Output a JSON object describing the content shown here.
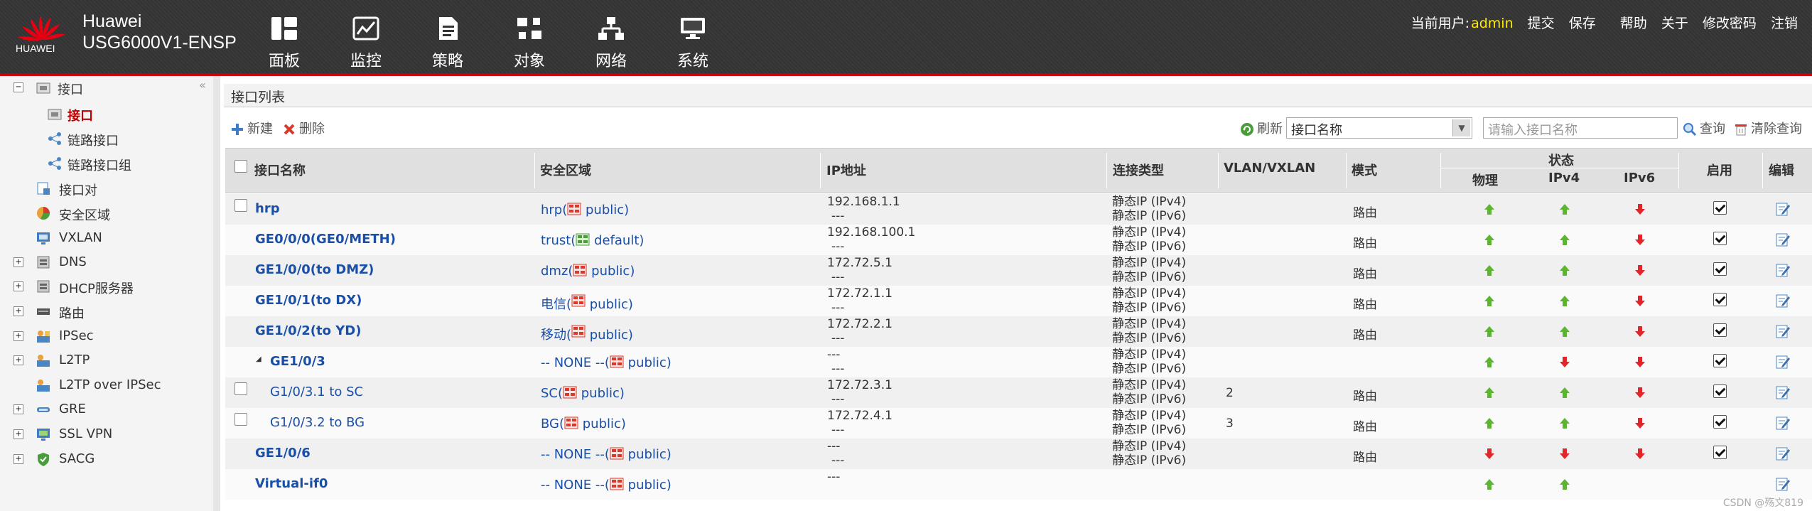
{
  "header": {
    "logo_text": "HUAWEI",
    "brand": "Huawei",
    "product": "USG6000V1-ENSP",
    "nav": [
      {
        "label": "面板",
        "icon": "dashboard-icon"
      },
      {
        "label": "监控",
        "icon": "monitor-icon"
      },
      {
        "label": "策略",
        "icon": "policy-icon"
      },
      {
        "label": "对象",
        "icon": "object-icon"
      },
      {
        "label": "网络",
        "icon": "network-icon"
      },
      {
        "label": "系统",
        "icon": "system-icon"
      }
    ],
    "current_user_label": "当前用户:",
    "current_user": "admin",
    "links": [
      "提交",
      "保存",
      "帮助",
      "关于",
      "修改密码",
      "注销"
    ],
    "accent": "#c7000b"
  },
  "sidebar": {
    "items": [
      {
        "label": "接口",
        "expander": "−"
      },
      {
        "label": "接口",
        "selected": true
      },
      {
        "label": "链路接口"
      },
      {
        "label": "链路接口组"
      },
      {
        "label": "接口对"
      },
      {
        "label": "安全区域"
      },
      {
        "label": "VXLAN"
      },
      {
        "label": "DNS",
        "expander": "+"
      },
      {
        "label": "DHCP服务器",
        "expander": "+"
      },
      {
        "label": "路由",
        "expander": "+"
      },
      {
        "label": "IPSec",
        "expander": "+"
      },
      {
        "label": "L2TP",
        "expander": "+"
      },
      {
        "label": "L2TP over IPSec"
      },
      {
        "label": "GRE",
        "expander": "+"
      },
      {
        "label": "SSL VPN",
        "expander": "+"
      },
      {
        "label": "SACG",
        "expander": "+"
      }
    ]
  },
  "main": {
    "title": "接口列表",
    "toolbar": {
      "new": "新建",
      "delete": "删除",
      "refresh": "刷新",
      "filter_select": "接口名称",
      "search_placeholder": "请输入接口名称",
      "query": "查询",
      "clear_query": "清除查询"
    },
    "columns": {
      "name": "接口名称",
      "zone": "安全区域",
      "ip": "IP地址",
      "conn": "连接类型",
      "vlan": "VLAN/VXLAN",
      "mode": "模式",
      "status": "状态",
      "status_phys": "物理",
      "status_ipv4": "IPv4",
      "status_ipv6": "IPv6",
      "enable": "启用",
      "edit": "编辑"
    },
    "rows": [
      {
        "name": "hrp",
        "checkbox": true,
        "zone_name": "hrp(",
        "zone_vsys": " public)",
        "ip1": "192.168.1.1",
        "ip2": "---",
        "conn1": "静态IP (IPv4)",
        "conn2": "静态IP (IPv6)",
        "vlan": "",
        "mode": "路由",
        "phys": "up",
        "ipv4": "up",
        "ipv6": "down",
        "enabled": true
      },
      {
        "name": "GE0/0/0(GE0/METH)",
        "checkbox": false,
        "zone_name": "trust(",
        "zone_vsys": " default)",
        "zone_icon": "green",
        "ip1": "192.168.100.1",
        "ip2": "---",
        "conn1": "静态IP (IPv4)",
        "conn2": "静态IP (IPv6)",
        "vlan": "",
        "mode": "路由",
        "phys": "up",
        "ipv4": "up",
        "ipv6": "down",
        "enabled": true
      },
      {
        "name": "GE1/0/0(to DMZ)",
        "checkbox": false,
        "zone_name": "dmz(",
        "zone_vsys": " public)",
        "ip1": "172.72.5.1",
        "ip2": "---",
        "conn1": "静态IP (IPv4)",
        "conn2": "静态IP (IPv6)",
        "vlan": "",
        "mode": "路由",
        "phys": "up",
        "ipv4": "up",
        "ipv6": "down",
        "enabled": true
      },
      {
        "name": "GE1/0/1(to DX)",
        "checkbox": false,
        "zone_name": "电信(",
        "zone_vsys": " public)",
        "ip1": "172.72.1.1",
        "ip2": "---",
        "conn1": "静态IP (IPv4)",
        "conn2": "静态IP (IPv6)",
        "vlan": "",
        "mode": "路由",
        "phys": "up",
        "ipv4": "up",
        "ipv6": "down",
        "enabled": true
      },
      {
        "name": "GE1/0/2(to YD)",
        "checkbox": false,
        "zone_name": "移动(",
        "zone_vsys": " public)",
        "ip1": "172.72.2.1",
        "ip2": "---",
        "conn1": "静态IP (IPv4)",
        "conn2": "静态IP (IPv6)",
        "vlan": "",
        "mode": "路由",
        "phys": "up",
        "ipv4": "up",
        "ipv6": "down",
        "enabled": true
      },
      {
        "name": "GE1/0/3",
        "checkbox": false,
        "expander": "◢",
        "zone_name": "-- NONE --(",
        "zone_vsys": " public)",
        "ip1": "---",
        "ip2": "---",
        "conn1": "静态IP (IPv4)",
        "conn2": "静态IP (IPv6)",
        "vlan": "",
        "mode": "",
        "phys": "up",
        "ipv4": "down",
        "ipv6": "down",
        "enabled": true
      },
      {
        "name": "G1/0/3.1 to SC",
        "checkbox": true,
        "child": true,
        "zone_name": "SC(",
        "zone_vsys": " public)",
        "ip1": "172.72.3.1",
        "ip2": "---",
        "conn1": "静态IP (IPv4)",
        "conn2": "静态IP (IPv6)",
        "vlan": "2",
        "mode": "路由",
        "phys": "up",
        "ipv4": "up",
        "ipv6": "down",
        "enabled": true
      },
      {
        "name": "G1/0/3.2 to BG",
        "checkbox": true,
        "child": true,
        "zone_name": "BG(",
        "zone_vsys": " public)",
        "ip1": "172.72.4.1",
        "ip2": "---",
        "conn1": "静态IP (IPv4)",
        "conn2": "静态IP (IPv6)",
        "vlan": "3",
        "mode": "路由",
        "phys": "up",
        "ipv4": "up",
        "ipv6": "down",
        "enabled": true
      },
      {
        "name": "GE1/0/6",
        "checkbox": false,
        "zone_name": "-- NONE --(",
        "zone_vsys": " public)",
        "ip1": "---",
        "ip2": "---",
        "conn1": "静态IP (IPv4)",
        "conn2": "静态IP (IPv6)",
        "vlan": "",
        "mode": "路由",
        "phys": "down",
        "ipv4": "down",
        "ipv6": "down",
        "enabled": true
      },
      {
        "name": "Virtual-if0",
        "checkbox": false,
        "zone_name": "-- NONE --(",
        "zone_vsys": " public)",
        "ip1": "---",
        "ip2": "",
        "conn1": "",
        "conn2": "",
        "vlan": "",
        "mode": "",
        "phys": "up",
        "ipv4": "up",
        "ipv6": "",
        "enabled": false
      }
    ],
    "status_colors": {
      "up": "#5cb531",
      "down": "#e0262b"
    }
  },
  "footer": "CSDN @殇文819"
}
